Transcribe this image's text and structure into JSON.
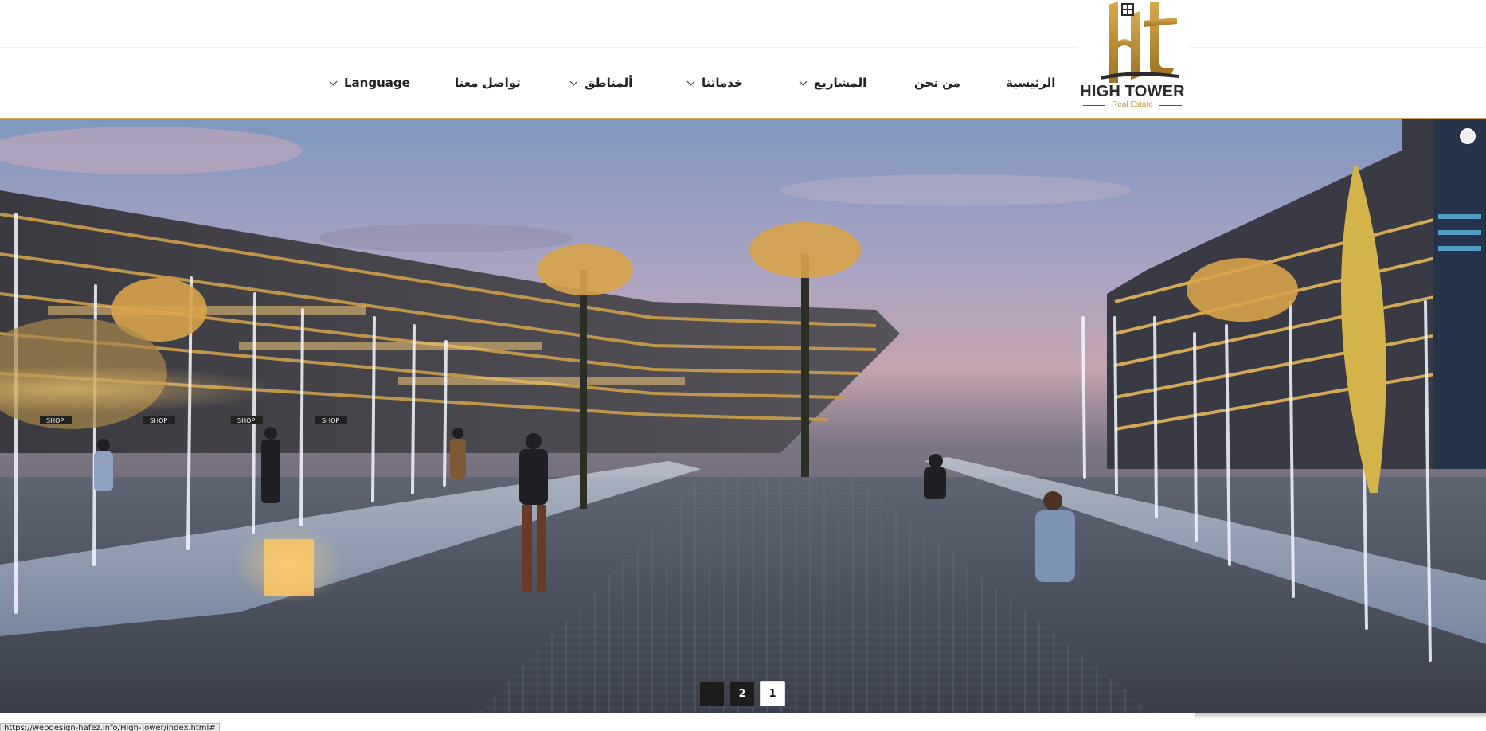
{
  "brand": {
    "name": "HIGH TOWER",
    "tagline": "Real Estate",
    "colors": {
      "gold": "#c49a3c",
      "dark": "#2d2a2b"
    }
  },
  "nav": {
    "items": [
      {
        "label": "الرئيسية",
        "has_dropdown": false
      },
      {
        "label": "من نحن",
        "has_dropdown": false
      },
      {
        "label": "المشاريع",
        "has_dropdown": true
      },
      {
        "label": "خدماتنا",
        "has_dropdown": true
      },
      {
        "label": "ألمناطق",
        "has_dropdown": true
      },
      {
        "label": "تواصل معنا",
        "has_dropdown": false
      },
      {
        "label": "Language",
        "has_dropdown": true
      }
    ],
    "accent_color": "#c9a44c"
  },
  "hero": {
    "image": "render-of-plaza-with-palm-trees-and-fountains",
    "signs": [
      "SHOP",
      "SHOP",
      "SHOP",
      "SHOP"
    ],
    "pagination": {
      "pages": [
        "",
        "2",
        "1"
      ],
      "active_page": "1"
    }
  },
  "status_bar": {
    "url": "https://webdesign-hafez.info/High-Tower/index.html#"
  }
}
